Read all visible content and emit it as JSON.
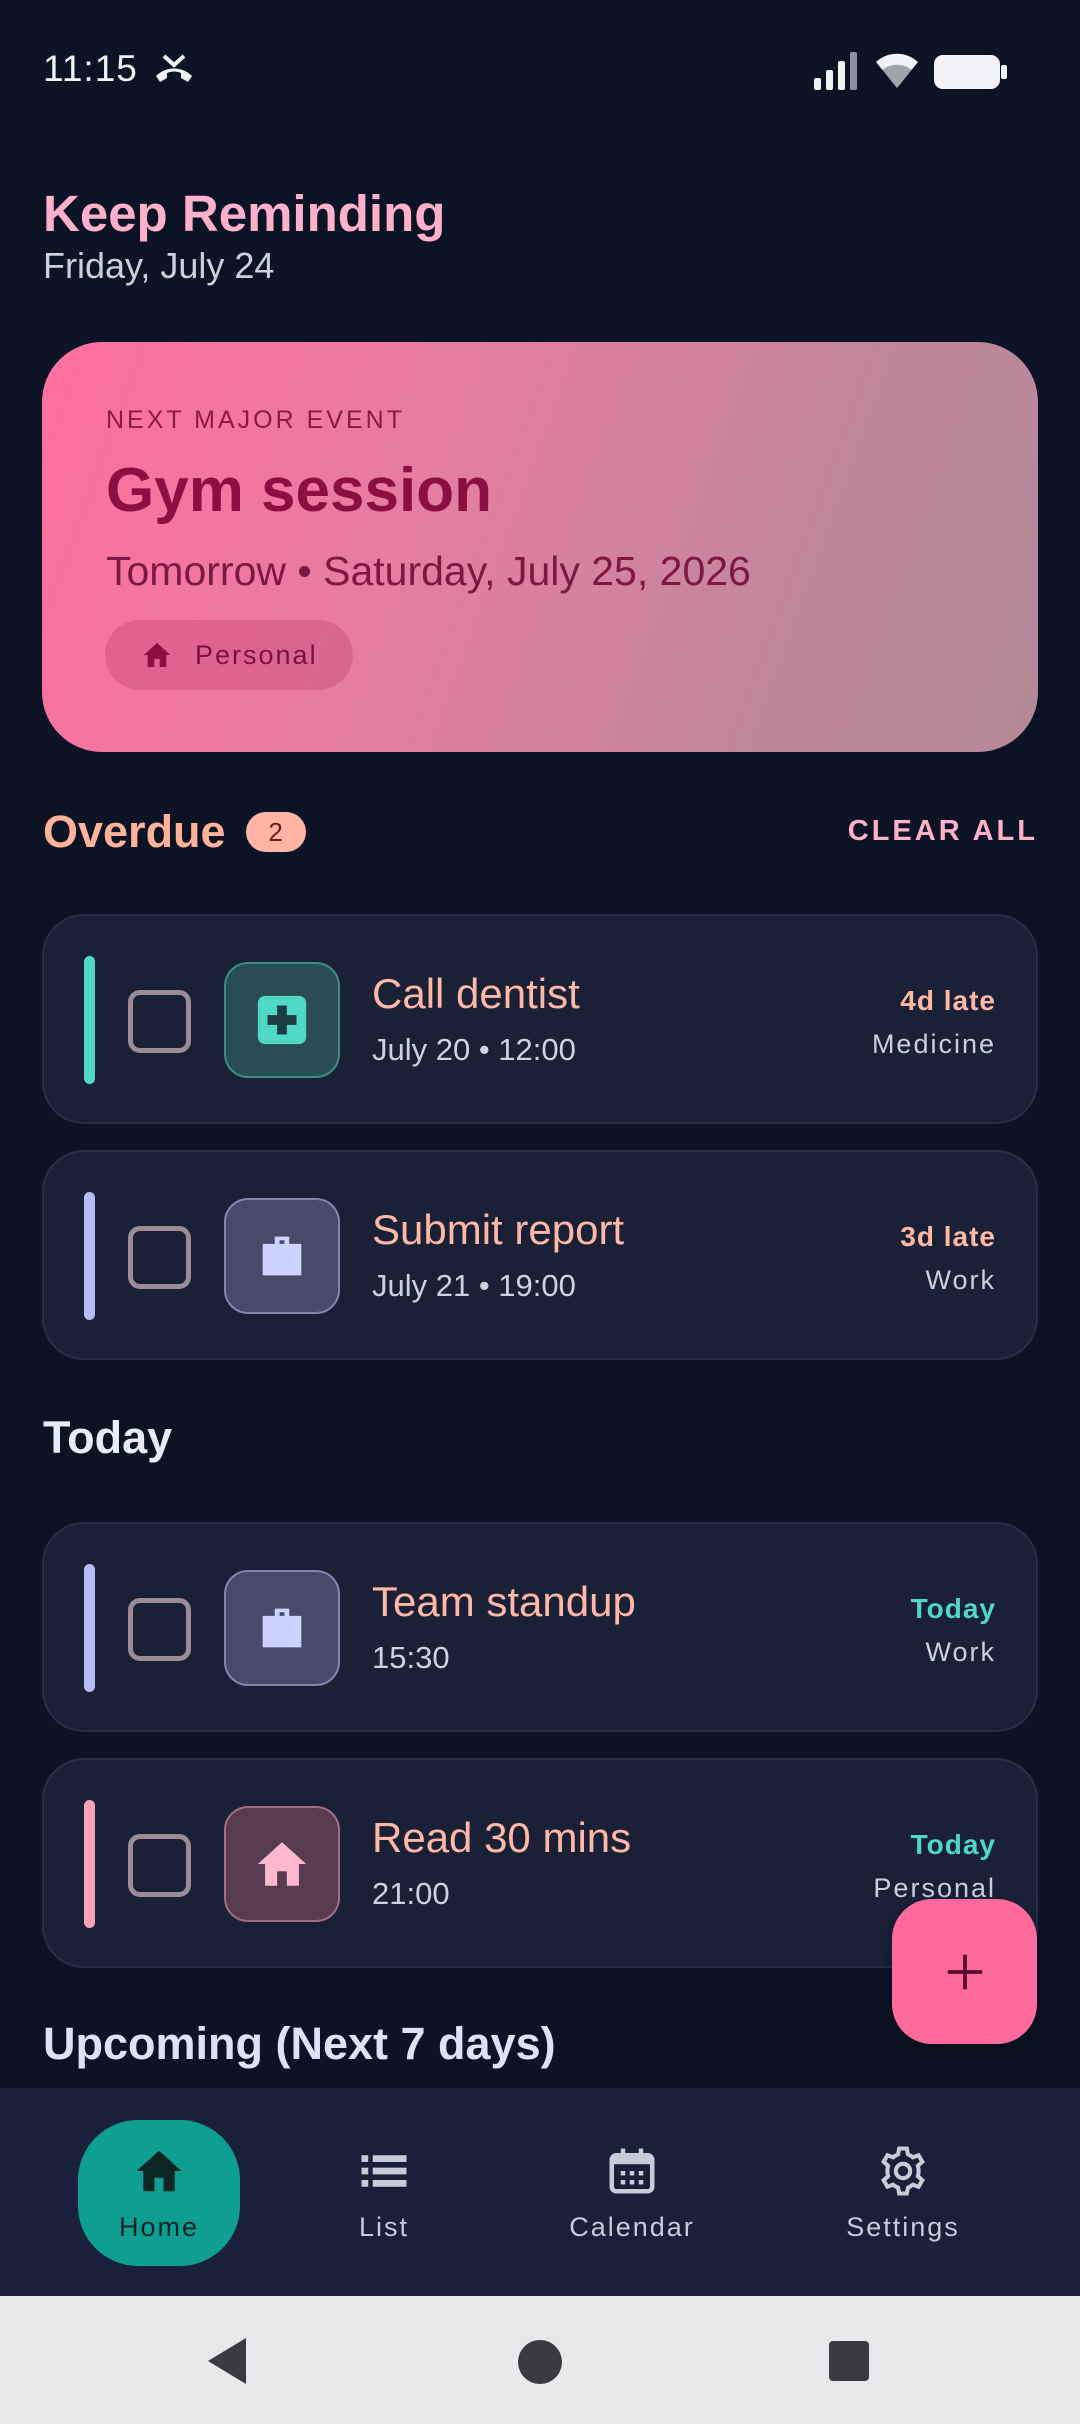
{
  "status_bar": {
    "time": "11:15",
    "icons": [
      "missed-call-icon",
      "signal-icon",
      "wifi-icon",
      "battery-icon"
    ]
  },
  "header": {
    "title": "Keep Reminding",
    "date": "Friday, July 24"
  },
  "hero": {
    "eyebrow": "NEXT MAJOR EVENT",
    "title": "Gym session",
    "subtitle": "Tomorrow • Saturday, July 25, 2026",
    "chip_label": "Personal",
    "chip_icon": "home-icon"
  },
  "overdue": {
    "title": "Overdue",
    "count": "2",
    "clear_all": "CLEAR ALL",
    "tasks": [
      {
        "title": "Call dentist",
        "meta": "July 20 • 12:00",
        "status": "4d late",
        "category": "Medicine",
        "icon": "medical-icon",
        "accent": "#4fd8c4"
      },
      {
        "title": "Submit report",
        "meta": "July 21 • 19:00",
        "status": "3d late",
        "category": "Work",
        "icon": "briefcase-icon",
        "accent": "#b4bdf7"
      }
    ]
  },
  "today": {
    "title": "Today",
    "tasks": [
      {
        "title": "Team standup",
        "meta": "15:30",
        "status": "Today",
        "category": "Work",
        "icon": "briefcase-icon",
        "accent": "#b4bdf7"
      },
      {
        "title": "Read 30 mins",
        "meta": "21:00",
        "status": "Today",
        "category": "Personal",
        "icon": "home-icon",
        "accent": "#ff9fba"
      }
    ]
  },
  "upcoming": {
    "title": "Upcoming (Next 7 days)"
  },
  "fab": {
    "icon": "plus-icon"
  },
  "bottom_nav": {
    "items": [
      {
        "label": "Home",
        "icon": "home-icon",
        "active": true
      },
      {
        "label": "List",
        "icon": "list-icon",
        "active": false
      },
      {
        "label": "Calendar",
        "icon": "calendar-icon",
        "active": false
      },
      {
        "label": "Settings",
        "icon": "gear-icon",
        "active": false
      }
    ]
  },
  "colors": {
    "background": "#0c1324",
    "accent_pink": "#ff6a9c",
    "overdue_text": "#ffb8a6",
    "today_status": "#4fd8c4",
    "late_status": "#ffb8a6",
    "nav_active": "#0f9f92"
  }
}
